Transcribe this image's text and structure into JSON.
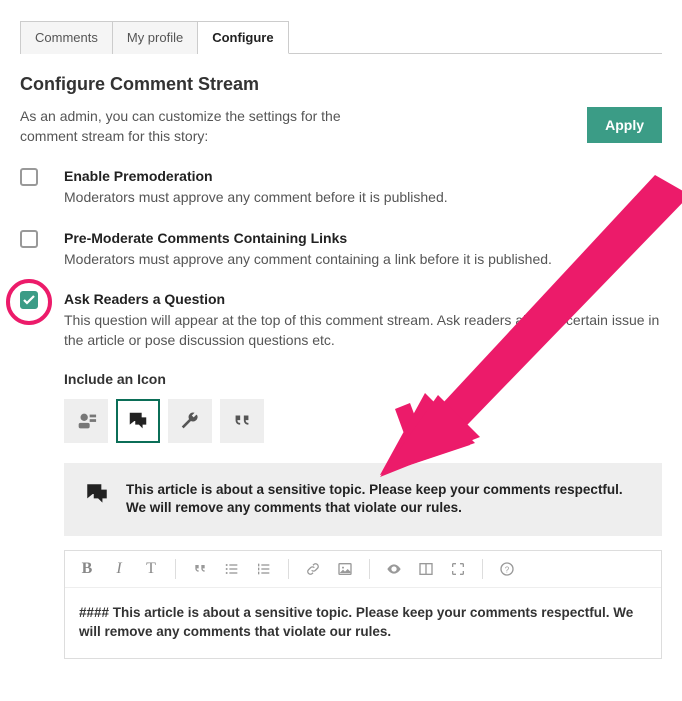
{
  "tabs": {
    "comments": "Comments",
    "profile": "My profile",
    "configure": "Configure"
  },
  "page": {
    "title": "Configure Comment Stream",
    "intro": "As an admin, you can customize the settings for the comment stream for this story:",
    "apply": "Apply"
  },
  "settings": {
    "premod": {
      "title": "Enable Premoderation",
      "desc": "Moderators must approve any comment before it is published."
    },
    "premod_links": {
      "title": "Pre-Moderate Comments Containing Links",
      "desc": "Moderators must approve any comment containing a link before it is published."
    },
    "ask": {
      "title": "Ask Readers a Question",
      "desc": "This question will appear at the top of this comment stream. Ask readers about a certain issue in the article or pose discussion questions etc.",
      "icon_label": "Include an Icon"
    }
  },
  "preview": {
    "text": "This article is about a sensitive topic. Please keep your comments respectful. We will remove any comments that violate our rules."
  },
  "editor": {
    "content": "#### This article is about a sensitive topic. Please keep your comments respectful. We will remove any comments that violate our rules."
  }
}
